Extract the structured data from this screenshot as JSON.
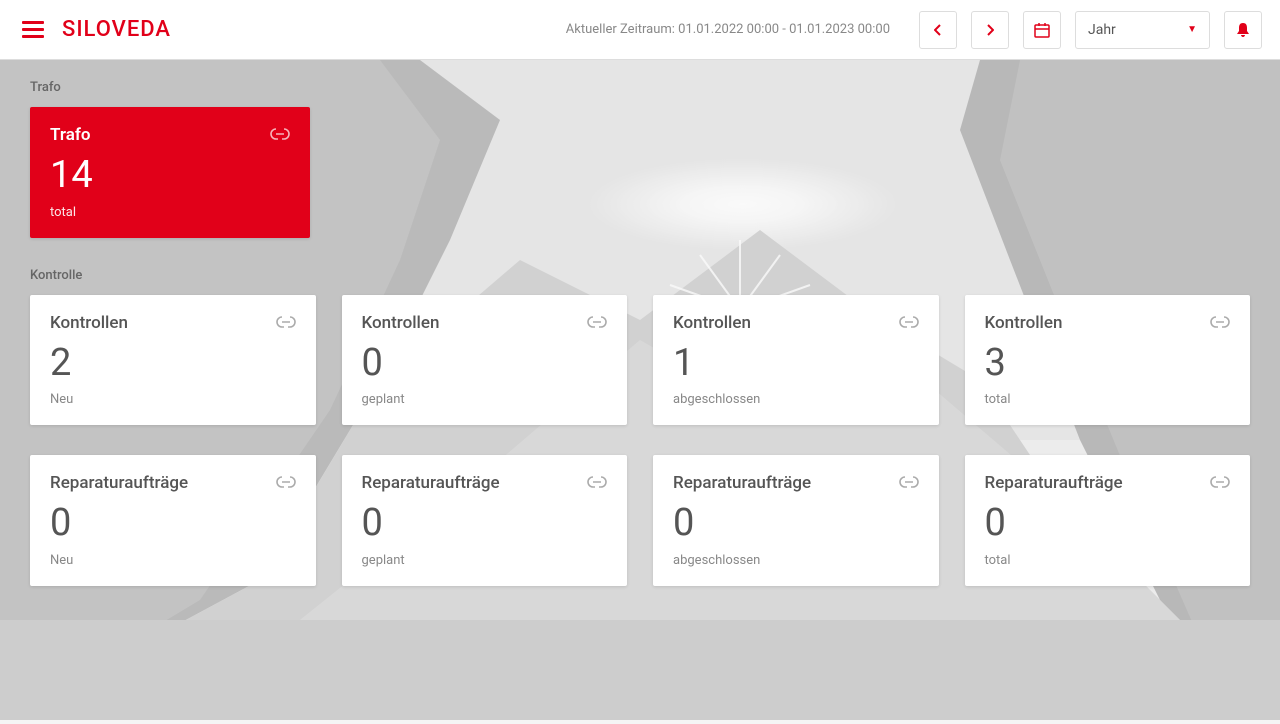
{
  "brand": "SILOVEDA",
  "header": {
    "period_text": "Aktueller Zeitraum: 01.01.2022 00:00 - 01.01.2023 00:00",
    "dropdown_value": "Jahr"
  },
  "sections": {
    "trafo": {
      "label": "Trafo",
      "card": {
        "title": "Trafo",
        "value": "14",
        "sublabel": "total"
      }
    },
    "kontrolle": {
      "label": "Kontrolle",
      "row1": [
        {
          "title": "Kontrollen",
          "value": "2",
          "sublabel": "Neu"
        },
        {
          "title": "Kontrollen",
          "value": "0",
          "sublabel": "geplant"
        },
        {
          "title": "Kontrollen",
          "value": "1",
          "sublabel": "abgeschlossen"
        },
        {
          "title": "Kontrollen",
          "value": "3",
          "sublabel": "total"
        }
      ],
      "row2": [
        {
          "title": "Reparaturaufträge",
          "value": "0",
          "sublabel": "Neu"
        },
        {
          "title": "Reparaturaufträge",
          "value": "0",
          "sublabel": "geplant"
        },
        {
          "title": "Reparaturaufträge",
          "value": "0",
          "sublabel": "abgeschlossen"
        },
        {
          "title": "Reparaturaufträge",
          "value": "0",
          "sublabel": "total"
        }
      ]
    }
  }
}
